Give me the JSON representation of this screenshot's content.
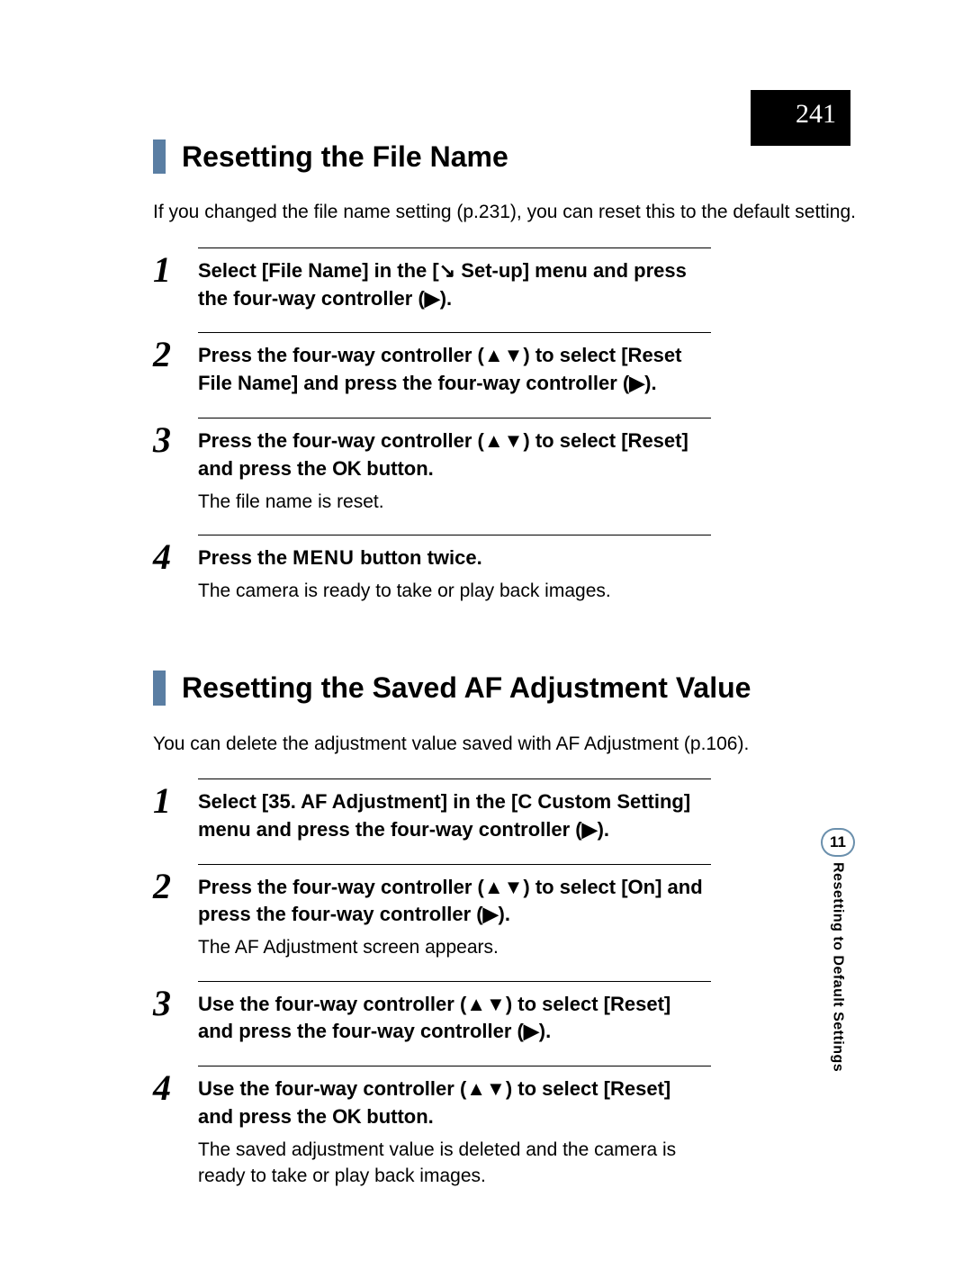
{
  "page_number": "241",
  "sidebar": {
    "chapter_number": "11",
    "chapter_title": "Resetting to Default Settings"
  },
  "section1": {
    "heading": "Resetting the File Name",
    "intro": "If you changed the file name setting (p.231), you can reset this to the default setting.",
    "steps": [
      {
        "num": "1",
        "title_parts": [
          "Select [File Name] in the [",
          "↘",
          " Set-up] menu and press the four-way controller (",
          "▶",
          ")."
        ]
      },
      {
        "num": "2",
        "title_parts": [
          "Press the four-way controller (",
          "▲▼",
          ") to select [Reset File Name] and press the four-way controller (",
          "▶",
          ")."
        ]
      },
      {
        "num": "3",
        "title_parts": [
          "Press the four-way controller (",
          "▲▼",
          ") to select [Reset] and press the ",
          "OK",
          " button."
        ],
        "body": "The file name is reset."
      },
      {
        "num": "4",
        "title_parts": [
          "Press the ",
          "MENU",
          " button twice."
        ],
        "body": "The camera is ready to take or play back images."
      }
    ]
  },
  "section2": {
    "heading": "Resetting the Saved AF Adjustment Value",
    "intro": "You can delete the adjustment value saved with AF Adjustment (p.106).",
    "steps": [
      {
        "num": "1",
        "title_parts": [
          "Select [35. AF Adjustment] in the [",
          "C",
          " Custom Setting] menu and press the four-way controller (",
          "▶",
          ")."
        ]
      },
      {
        "num": "2",
        "title_parts": [
          "Press the four-way controller (",
          "▲▼",
          ") to select [On] and press the four-way controller (",
          "▶",
          ")."
        ],
        "body": "The AF Adjustment screen appears."
      },
      {
        "num": "3",
        "title_parts": [
          "Use the four-way controller (",
          "▲▼",
          ") to select [Reset] and press the four-way controller (",
          "▶",
          ")."
        ]
      },
      {
        "num": "4",
        "title_parts": [
          "Use the four-way controller (",
          "▲▼",
          ") to select [Reset] and press the ",
          "OK",
          " button."
        ],
        "body": "The saved adjustment value is deleted and the camera is ready to take or play back images."
      }
    ]
  }
}
